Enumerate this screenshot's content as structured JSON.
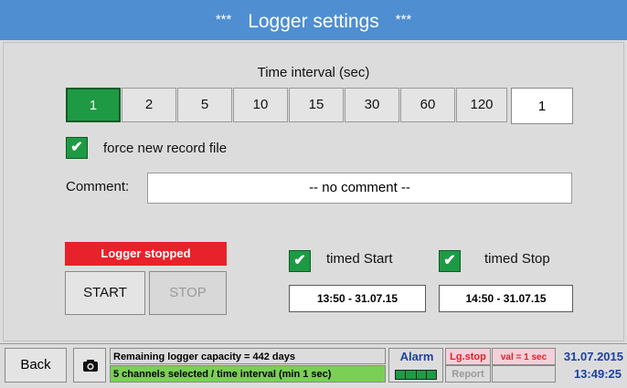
{
  "header": {
    "stars_left": "***",
    "title": "Logger settings",
    "stars_right": "***"
  },
  "interval": {
    "label": "Time interval (sec)",
    "options": [
      "1",
      "2",
      "5",
      "10",
      "15",
      "30",
      "60",
      "120"
    ],
    "selected": "1",
    "value": "1"
  },
  "force_new": {
    "checked": "✔",
    "label": "force new record file"
  },
  "comment": {
    "label": "Comment:",
    "value": "-- no comment --"
  },
  "logger": {
    "status": "Logger stopped",
    "start": "START",
    "stop": "STOP"
  },
  "timed_start": {
    "checked": "✔",
    "label": "timed Start",
    "value": "13:50 - 31.07.15"
  },
  "timed_stop": {
    "checked": "✔",
    "label": "timed Stop",
    "value": "14:50 - 31.07.15"
  },
  "statusbar": {
    "back": "Back",
    "camera_icon": "camera-icon",
    "capacity": "Remaining logger capacity = 442 days",
    "channels": "5 channels selected / time interval (min 1 sec)",
    "alarm": "Alarm",
    "lg_stop": "Lg.stop",
    "report": "Report",
    "val": "val = 1 sec",
    "date": "31.07.2015",
    "time": "13:49:25"
  },
  "colors": {
    "title_bar": "#4e8ed1",
    "selected": "#1e9a44",
    "alarm_red": "#e8222a",
    "status_blue": "#1a3fa8"
  }
}
